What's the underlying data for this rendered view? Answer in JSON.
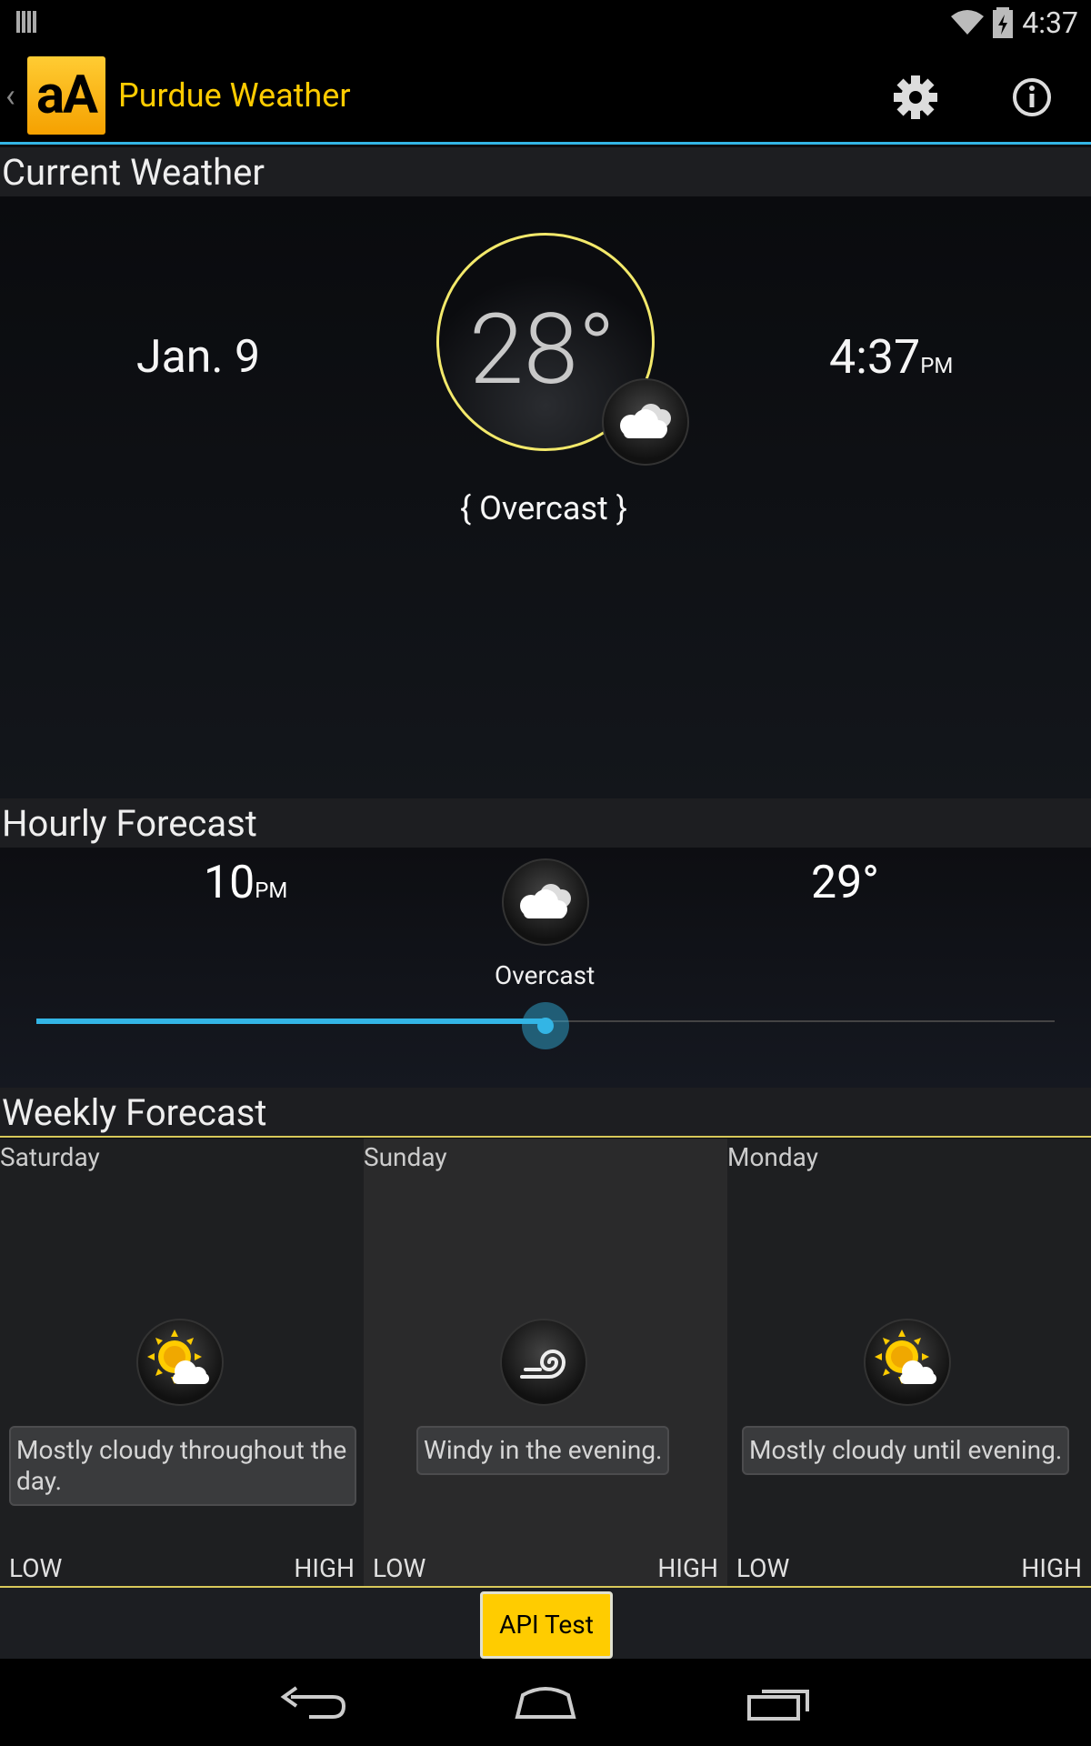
{
  "status_bar": {
    "time": "4:37"
  },
  "app": {
    "title": "Purdue Weather",
    "logo_text": "aA",
    "back_caret": "‹"
  },
  "action_bar": {
    "settings_icon": "gear-icon",
    "info_icon": "info-icon"
  },
  "current": {
    "header": "Current Weather",
    "date": "Jan. 9",
    "temperature": "28°",
    "time": "4:37",
    "time_suffix": "PM",
    "condition": "{ Overcast }",
    "icon": "cloud-icon"
  },
  "hourly": {
    "header": "Hourly Forecast",
    "time": "10",
    "time_suffix": "PM",
    "temperature": "29°",
    "condition": "Overcast",
    "icon": "cloud-icon",
    "slider_fraction": 0.5
  },
  "weekly": {
    "header": "Weekly Forecast",
    "days": [
      {
        "name": "Saturday",
        "icon": "partly-cloudy-icon",
        "summary": "Mostly cloudy throughout the day.",
        "low_label": "LOW",
        "high_label": "HIGH"
      },
      {
        "name": "Sunday",
        "icon": "wind-icon",
        "summary": "Windy in the evening.",
        "low_label": "LOW",
        "high_label": "HIGH"
      },
      {
        "name": "Monday",
        "icon": "partly-cloudy-icon",
        "summary": "Mostly cloudy until evening.",
        "low_label": "LOW",
        "high_label": "HIGH"
      }
    ]
  },
  "toolbar": {
    "api_test_label": "API Test"
  },
  "colors": {
    "accent_blue": "#33b5e5",
    "accent_yellow": "#ffcc00",
    "ring": "#f3e96b"
  }
}
